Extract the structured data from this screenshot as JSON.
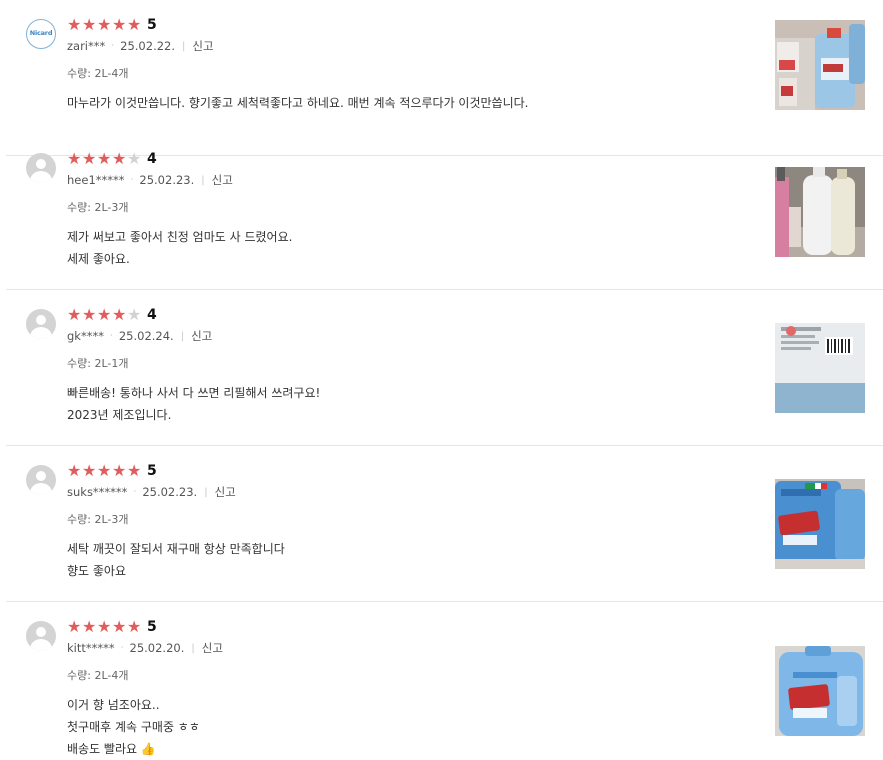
{
  "reviews": [
    {
      "stars": 5,
      "score": "5",
      "user": "zari***",
      "date": "25.02.22.",
      "report": "신고",
      "option": "수량: 2L-4개",
      "lines": [
        "마누라가 이것만씁니다. 향기좋고 세척력좋다고 하네요. 매번 계속 적으루다가 이것만씁니다."
      ],
      "avatar": "logo",
      "avatar_text": "Nicard"
    },
    {
      "stars": 4,
      "score": "4",
      "user": "hee1*****",
      "date": "25.02.23.",
      "report": "신고",
      "option": "수량: 2L-3개",
      "lines": [
        "제가 써보고 좋아서 친정 엄마도 사 드렸어요.",
        "세제 좋아요."
      ],
      "avatar": "default"
    },
    {
      "stars": 4,
      "score": "4",
      "user": "gk****",
      "date": "25.02.24.",
      "report": "신고",
      "option": "수량: 2L-1개",
      "lines": [
        "빠른배송! 통하나 사서 다 쓰면 리필해서 쓰려구요!",
        "2023년 제조입니다."
      ],
      "avatar": "default"
    },
    {
      "stars": 5,
      "score": "5",
      "user": "suks******",
      "date": "25.02.23.",
      "report": "신고",
      "option": "수량: 2L-3개",
      "lines": [
        "세탁 깨끗이 잘되서 재구매 항상 만족합니다",
        "향도 좋아요"
      ],
      "avatar": "default"
    },
    {
      "stars": 5,
      "score": "5",
      "user": "kitt*****",
      "date": "25.02.20.",
      "report": "신고",
      "option": "수량: 2L-4개",
      "lines": [
        "이거 향 넘조아요..",
        "첫구매후 계속 구매중 ㅎㅎ",
        "배송도 빨라요 👍"
      ],
      "avatar": "default"
    }
  ],
  "colors": {
    "star_on": "#e15d5d",
    "star_off": "#d2d2d2",
    "divider": "#e6e6e6"
  },
  "icons": {
    "star": "star-icon",
    "avatar": "default-user-icon"
  }
}
